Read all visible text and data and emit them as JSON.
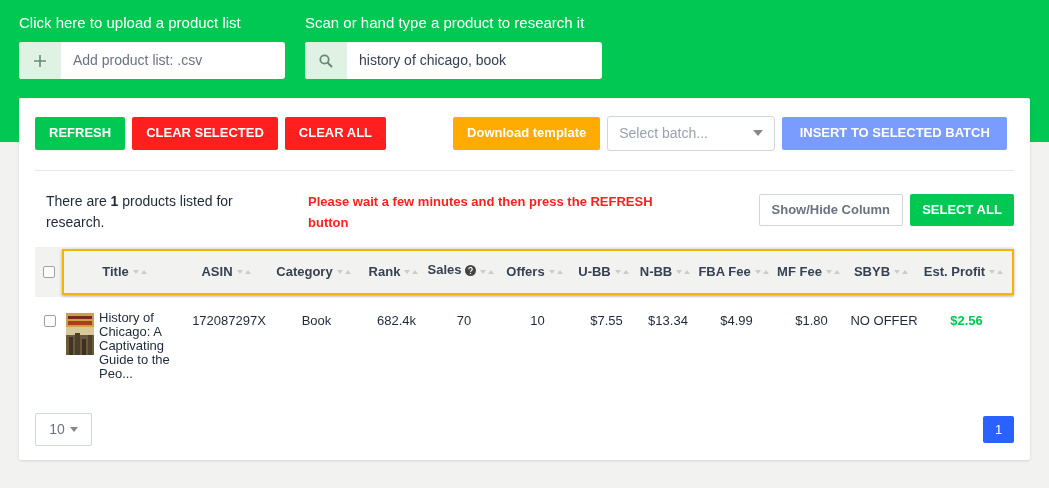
{
  "upload": {
    "label": "Click here to upload a product list",
    "placeholder": "Add product list: .csv"
  },
  "search": {
    "label": "Scan or hand type a product to research it",
    "value": "history of chicago, book"
  },
  "toolbar": {
    "buttons": [
      {
        "label": "REFRESH",
        "kind": "green"
      },
      {
        "label": "CLEAR SELECTED",
        "kind": "red"
      },
      {
        "label": "CLEAR ALL",
        "kind": "red"
      },
      {
        "label": "Download template",
        "kind": "orange"
      }
    ],
    "batch_select": {
      "placeholder": "Select batch..."
    },
    "insert_button": {
      "label": "INSERT TO SELECTED BATCH",
      "disabled": true
    }
  },
  "info": "There are **1** products listed for research.",
  "warning": "Please wait a few minutes and then press the REFRESH button",
  "show_hide_button": "Show/Hide Column",
  "select_all_button": "SELECT ALL",
  "table": {
    "select_all_checked": false,
    "columns": [
      {
        "label": "Title",
        "kind": "title",
        "help": false
      },
      {
        "label": "ASIN",
        "kind": "text",
        "help": false
      },
      {
        "label": "Category",
        "kind": "text",
        "help": false
      },
      {
        "label": "Rank",
        "kind": "text",
        "help": false
      },
      {
        "label": "Sales",
        "kind": "text",
        "help": true
      },
      {
        "label": "Offers",
        "kind": "text",
        "help": false
      },
      {
        "label": "U-BB",
        "kind": "text",
        "help": false
      },
      {
        "label": "N-BB",
        "kind": "text",
        "help": false
      },
      {
        "label": "FBA Fee",
        "kind": "text",
        "help": false
      },
      {
        "label": "MF Fee",
        "kind": "text",
        "help": false
      },
      {
        "label": "SBYB",
        "kind": "text",
        "help": false
      },
      {
        "label": "Est. Profit",
        "kind": "profit",
        "help": false
      }
    ],
    "rows": [
      {
        "checked": false,
        "cells": [
          "History of Chicago: A Captivating Guide to the Peo...",
          "172087297X",
          "Book",
          "682.4k",
          "70",
          "10",
          "$7.55",
          "$13.34",
          "$4.99",
          "$1.80",
          "NO OFFER",
          "$2.56"
        ]
      }
    ]
  },
  "pagination": {
    "page_size": "10",
    "pages": [
      {
        "label": "1",
        "selected": true
      }
    ]
  }
}
